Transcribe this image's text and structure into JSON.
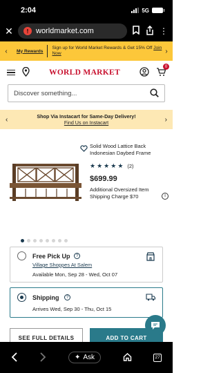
{
  "status_bar": {
    "time": "2:04",
    "network": "5G"
  },
  "browser": {
    "url": "worldmarket.com"
  },
  "rewards_banner": {
    "link": "My Rewards",
    "text": "Sign up for World Market Rewards & Get 15% Off",
    "cta": "Join Now"
  },
  "header": {
    "logo": "WORLD MARKET",
    "cart_count": "0"
  },
  "search": {
    "placeholder": "Discover something..."
  },
  "instacart_banner": {
    "title": "Shop Via Instacart for Same-Day Delivery!",
    "link": "Find Us on Instacart"
  },
  "product": {
    "title": "Solid Wood Lattice Back Indonesian Daybed Frame",
    "rating": 5,
    "review_count": "(2)",
    "price": "$699.99",
    "shipping_note": "Additional Oversized Item Shipping Charge $70",
    "image_index": 0,
    "image_count": 8
  },
  "fulfillment": {
    "pickup": {
      "label": "Free Pick Up",
      "store": "Village Shoppes At Salem",
      "availability": "Available Mon, Sep 28 - Wed, Oct 07",
      "selected": false
    },
    "shipping": {
      "label": "Shipping",
      "arrival": "Arrives Wed, Sep 30 - Thu, Oct 15",
      "selected": true
    }
  },
  "buttons": {
    "details": "SEE FULL DETAILS",
    "add_to_cart": "ADD TO CART"
  },
  "bottom_nav": {
    "ask": "Ask",
    "tab_count": "27"
  },
  "colors": {
    "brand_red": "#c8102e",
    "teal": "#2a7a8a",
    "navy": "#1a3a4f",
    "banner_yellow": "#fcc73a"
  }
}
